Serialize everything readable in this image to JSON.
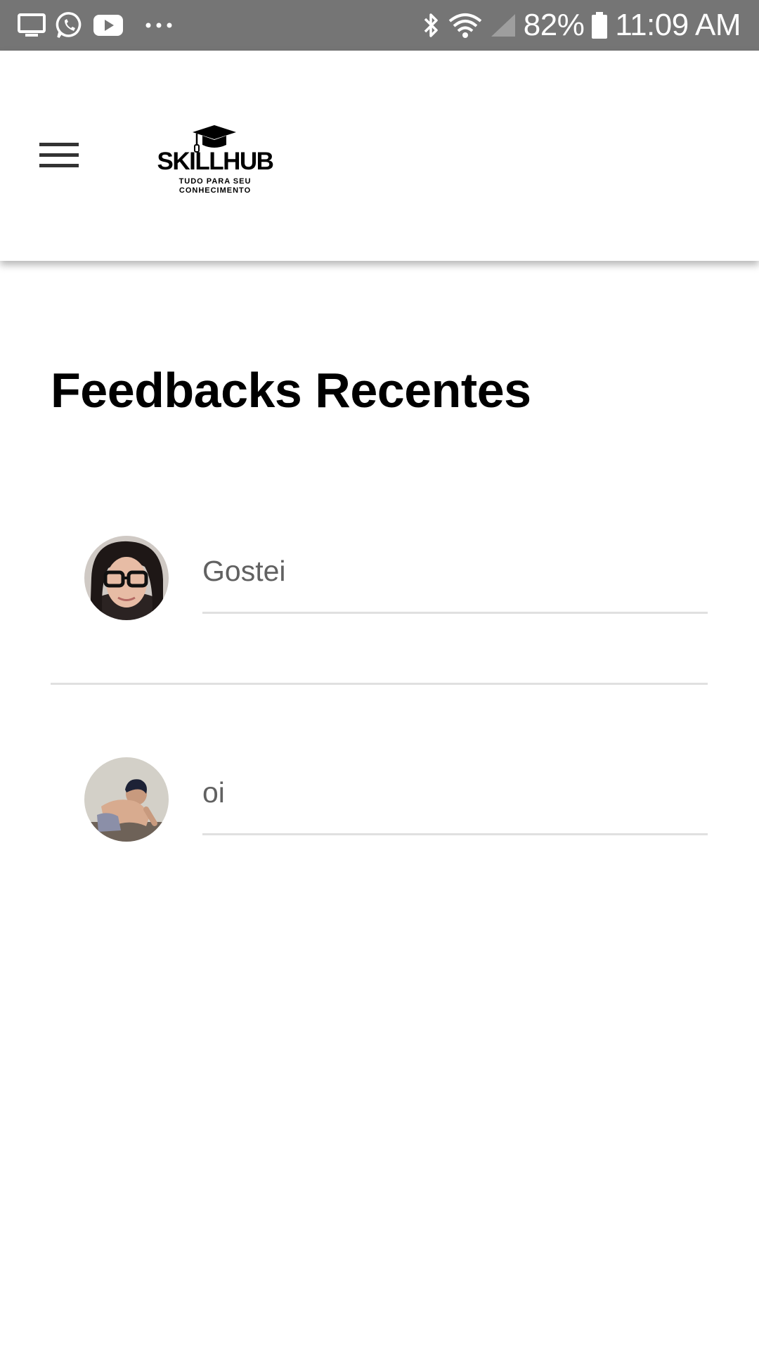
{
  "status_bar": {
    "icons_left": [
      "screen-icon",
      "whatsapp-icon",
      "youtube-icon",
      "more-dots-icon"
    ],
    "icons_right": [
      "bluetooth-icon",
      "wifi-icon",
      "signal-icon",
      "battery-icon"
    ],
    "battery": "82%",
    "time": "11:09 AM",
    "bar_color": "#757575"
  },
  "header": {
    "menu_icon": "hamburger-menu-icon",
    "logo": {
      "title": "SKILLHUB",
      "tagline_line1": "TUDO PARA SEU",
      "tagline_line2": "CONHECIMENTO",
      "icon": "graduation-cap-icon"
    }
  },
  "main": {
    "title": "Feedbacks Recentes",
    "feedbacks": [
      {
        "text": "Gostei",
        "avatar": "user-avatar-woman-glasses"
      },
      {
        "text": "oi",
        "avatar": "user-avatar-child"
      }
    ]
  }
}
